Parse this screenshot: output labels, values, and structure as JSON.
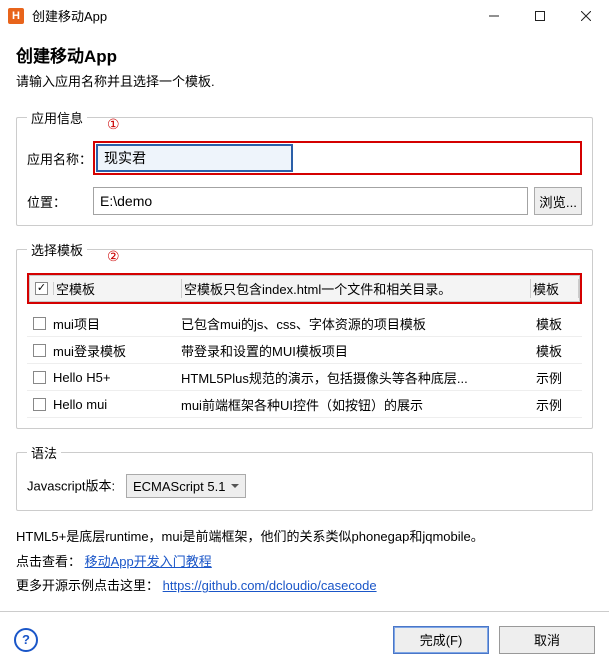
{
  "window": {
    "title": "创建移动App"
  },
  "header": {
    "title": "创建移动App",
    "subtitle": "请输入应用名称并且选择一个模板."
  },
  "annotations": {
    "c1": "①",
    "c2": "②"
  },
  "appInfo": {
    "legend": "应用信息",
    "nameLabel": "应用名称：",
    "nameValue": "现实君",
    "locLabel": "位置：",
    "locValue": "E:\\demo",
    "browse": "浏览..."
  },
  "tpl": {
    "legend": "选择模板",
    "typeCol": "模板",
    "rows": [
      {
        "checked": true,
        "name": "空模板",
        "desc": "空模板只包含index.html一个文件和相关目录。",
        "type": "模板"
      },
      {
        "checked": false,
        "name": "mui项目",
        "desc": "已包含mui的js、css、字体资源的项目模板",
        "type": "模板"
      },
      {
        "checked": false,
        "name": "mui登录模板",
        "desc": "带登录和设置的MUI模板项目",
        "type": "模板"
      },
      {
        "checked": false,
        "name": "Hello H5+",
        "desc": "HTML5Plus规范的演示，包括摄像头等各种底层...",
        "type": "示例"
      },
      {
        "checked": false,
        "name": "Hello mui",
        "desc": "mui前端框架各种UI控件（如按钮）的展示",
        "type": "示例"
      }
    ]
  },
  "syntax": {
    "legend": "语法",
    "jsLabel": "Javascript版本:",
    "jsValue": "ECMAScript 5.1"
  },
  "info": {
    "line1": "HTML5+是底层runtime，mui是前端框架，他们的关系类似phonegap和jqmobile。",
    "line2a": "点击查看：",
    "link1": "移动App开发入门教程",
    "line3a": "更多开源示例点击这里：",
    "link2": "https://github.com/dcloudio/casecode"
  },
  "footer": {
    "help": "?",
    "finish": "完成(F)",
    "cancel": "取消"
  }
}
